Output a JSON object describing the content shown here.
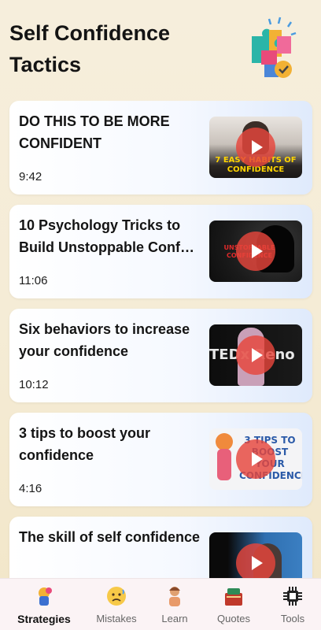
{
  "header": {
    "title": "Self Confidence Tactics"
  },
  "videos": [
    {
      "title": "DO THIS TO BE MORE CONFIDENT",
      "duration": "9:42",
      "thumb_text": "7 EASY HABITS OF CONFIDENCE"
    },
    {
      "title": "10 Psychology Tricks to Build Unstoppable Conf…",
      "duration": "11:06",
      "thumb_text": "UNSTOPPABLE CONFIDENCE"
    },
    {
      "title": "Six behaviors to increase your confidence",
      "duration": "10:12",
      "thumb_text": "TEDx Reno"
    },
    {
      "title": "3 tips to boost your confidence",
      "duration": "4:16",
      "thumb_text": "3 TIPS TO BOOST YOUR CONFIDENCE"
    },
    {
      "title": "The skill of self confidence",
      "duration": "",
      "thumb_text": ""
    }
  ],
  "nav": {
    "items": [
      {
        "label": "Strategies",
        "icon": "strategies-icon",
        "active": true
      },
      {
        "label": "Mistakes",
        "icon": "worried-face-icon",
        "active": false
      },
      {
        "label": "Learn",
        "icon": "learner-icon",
        "active": false
      },
      {
        "label": "Quotes",
        "icon": "quote-book-icon",
        "active": false
      },
      {
        "label": "Tools",
        "icon": "tools-chip-icon",
        "active": false
      }
    ]
  },
  "colors": {
    "background": "#f5ecd6",
    "card_gradient_end": "#dfeafc",
    "play_button": "#e6463c",
    "navbar": "#fbf3f5"
  }
}
